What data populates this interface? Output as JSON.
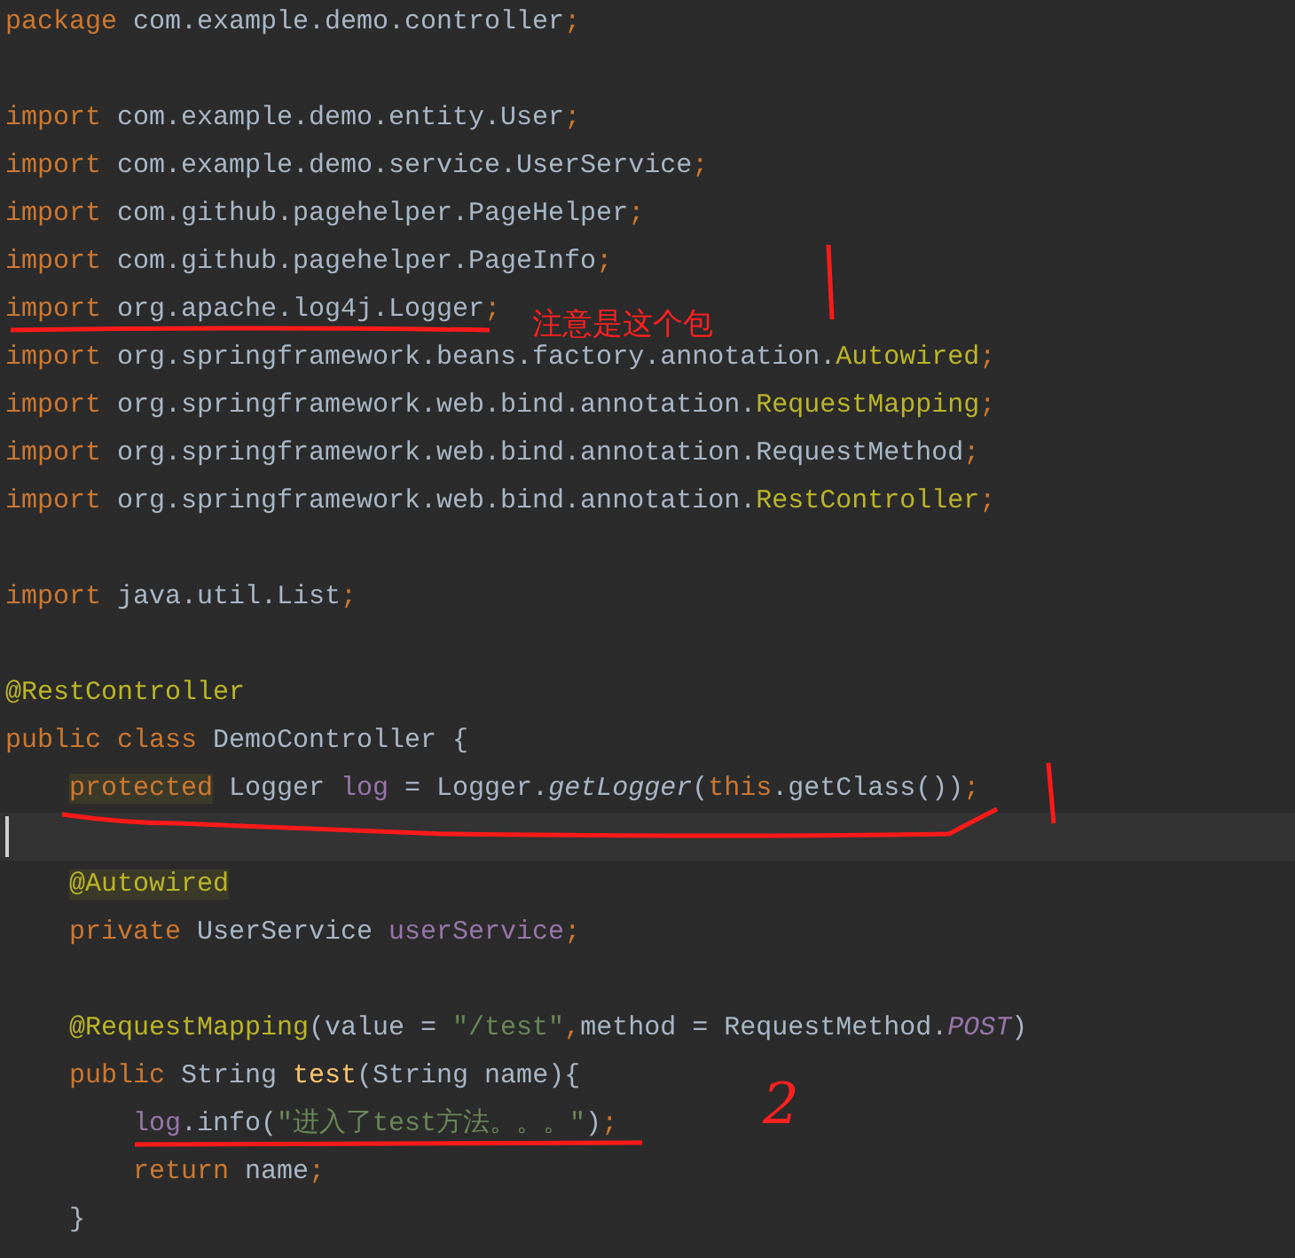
{
  "editor": {
    "lines": [
      {
        "current": false,
        "tokens": [
          {
            "text": "package",
            "kind": "keyword"
          },
          {
            "text": " com.example.demo.controller",
            "kind": "plain"
          },
          {
            "text": ";",
            "kind": "keyword"
          }
        ]
      },
      {
        "current": false
      },
      {
        "current": false,
        "tokens": [
          {
            "text": "import",
            "kind": "keyword"
          },
          {
            "text": " com.example.demo.entity.User",
            "kind": "plain"
          },
          {
            "text": ";",
            "kind": "keyword"
          }
        ]
      },
      {
        "current": false,
        "tokens": [
          {
            "text": "import",
            "kind": "keyword"
          },
          {
            "text": " com.example.demo.service.UserService",
            "kind": "plain"
          },
          {
            "text": ";",
            "kind": "keyword"
          }
        ]
      },
      {
        "current": false,
        "tokens": [
          {
            "text": "import",
            "kind": "keyword"
          },
          {
            "text": " com.github.pagehelper.PageHelper",
            "kind": "plain"
          },
          {
            "text": ";",
            "kind": "keyword"
          }
        ]
      },
      {
        "current": false,
        "tokens": [
          {
            "text": "import",
            "kind": "keyword"
          },
          {
            "text": " com.github.pagehelper.PageInfo",
            "kind": "plain"
          },
          {
            "text": ";",
            "kind": "keyword"
          }
        ]
      },
      {
        "current": false,
        "tokens": [
          {
            "text": "import",
            "kind": "keyword"
          },
          {
            "text": " org.apache.log4j.Logger",
            "kind": "plain"
          },
          {
            "text": ";",
            "kind": "keyword"
          }
        ]
      },
      {
        "current": false,
        "tokens": [
          {
            "text": "import",
            "kind": "keyword"
          },
          {
            "text": " org.springframework.beans.factory.annotation.",
            "kind": "plain"
          },
          {
            "text": "Autowired",
            "kind": "annotation"
          },
          {
            "text": ";",
            "kind": "keyword"
          }
        ]
      },
      {
        "current": false,
        "tokens": [
          {
            "text": "import",
            "kind": "keyword"
          },
          {
            "text": " org.springframework.web.bind.annotation.",
            "kind": "plain"
          },
          {
            "text": "RequestMapping",
            "kind": "annotation"
          },
          {
            "text": ";",
            "kind": "keyword"
          }
        ]
      },
      {
        "current": false,
        "tokens": [
          {
            "text": "import",
            "kind": "keyword"
          },
          {
            "text": " org.springframework.web.bind.annotation.RequestMethod",
            "kind": "plain"
          },
          {
            "text": ";",
            "kind": "keyword"
          }
        ]
      },
      {
        "current": false,
        "tokens": [
          {
            "text": "import",
            "kind": "keyword"
          },
          {
            "text": " org.springframework.web.bind.annotation.",
            "kind": "plain"
          },
          {
            "text": "RestController",
            "kind": "annotation"
          },
          {
            "text": ";",
            "kind": "keyword"
          }
        ]
      },
      {
        "current": false
      },
      {
        "current": false,
        "tokens": [
          {
            "text": "import",
            "kind": "keyword"
          },
          {
            "text": " java.util.List",
            "kind": "plain"
          },
          {
            "text": ";",
            "kind": "keyword"
          }
        ]
      },
      {
        "current": false
      },
      {
        "current": false,
        "tokens": [
          {
            "text": "@RestController",
            "kind": "annotation"
          }
        ]
      },
      {
        "current": false,
        "tokens": [
          {
            "text": "public class",
            "kind": "keyword"
          },
          {
            "text": " DemoController {",
            "kind": "plain"
          }
        ],
        "children": [
          {
            "current": false,
            "tokens": [
              {
                "text": "protected",
                "kind": "marked_keyword"
              },
              {
                "text": " Logger ",
                "kind": "plain"
              },
              {
                "text": "log",
                "kind": "field"
              },
              {
                "text": " = Logger.",
                "kind": "plain"
              },
              {
                "text": "getLogger",
                "kind": "static_call"
              },
              {
                "text": "(",
                "kind": "plain"
              },
              {
                "text": "this",
                "kind": "keyword"
              },
              {
                "text": ".getClass())",
                "kind": "plain"
              },
              {
                "text": ";",
                "kind": "keyword"
              }
            ]
          },
          {
            "current": true
          },
          {
            "current": false,
            "tokens": [
              {
                "text": "@Autowired",
                "kind": "marked_annotation"
              }
            ]
          },
          {
            "current": false,
            "tokens": [
              {
                "text": "private",
                "kind": "keyword"
              },
              {
                "text": " UserService ",
                "kind": "plain"
              },
              {
                "text": "userService",
                "kind": "field"
              },
              {
                "text": ";",
                "kind": "keyword"
              }
            ]
          },
          {
            "current": false
          },
          {
            "current": false,
            "tokens": [
              {
                "text": "@RequestMapping",
                "kind": "annotation"
              },
              {
                "text": "(value = ",
                "kind": "plain"
              },
              {
                "text": "\"/test\"",
                "kind": "string"
              },
              {
                "text": ",",
                "kind": "keyword"
              },
              {
                "text": "method = RequestMethod.",
                "kind": "plain"
              },
              {
                "text": "POST",
                "kind": "constant"
              },
              {
                "text": ")",
                "kind": "plain"
              }
            ]
          },
          {
            "current": false,
            "tokens": [
              {
                "text": "public",
                "kind": "keyword"
              },
              {
                "text": " String ",
                "kind": "plain"
              },
              {
                "text": "test",
                "kind": "method"
              },
              {
                "text": "(String name){",
                "kind": "plain"
              }
            ],
            "children": [
              {
                "current": false,
                "tokens": [
                  {
                    "text": "log",
                    "kind": "field"
                  },
                  {
                    "text": ".info(",
                    "kind": "plain"
                  },
                  {
                    "text": "\"进入了test方法。。。\"",
                    "kind": "string"
                  },
                  {
                    "text": ")",
                    "kind": "plain"
                  },
                  {
                    "text": ";",
                    "kind": "keyword"
                  }
                ]
              },
              {
                "current": false,
                "tokens": [
                  {
                    "text": "return",
                    "kind": "keyword"
                  },
                  {
                    "text": " name",
                    "kind": "plain"
                  },
                  {
                    "text": ";",
                    "kind": "keyword"
                  }
                ]
              }
            ]
          },
          {
            "current": false,
            "tokens": [
              {
                "text": "}",
                "kind": "plain"
              }
            ]
          }
        ]
      }
    ]
  },
  "notes": [
    {
      "kind": "text",
      "text": "注意是这个包"
    },
    {
      "kind": "number",
      "text": "2"
    }
  ]
}
